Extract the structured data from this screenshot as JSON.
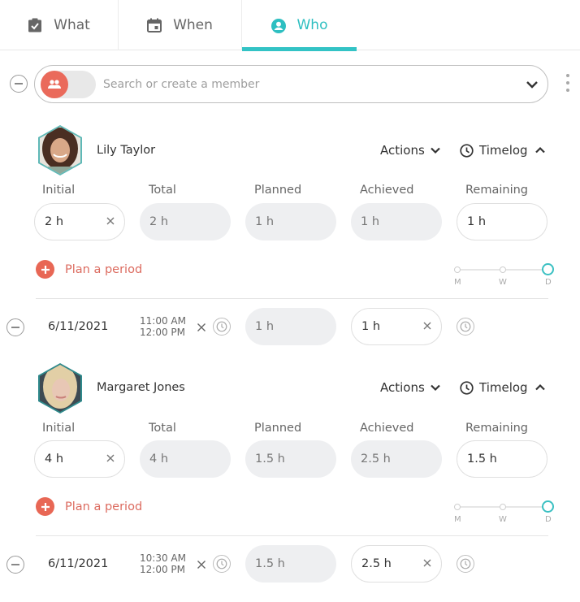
{
  "tabs": [
    {
      "label": "What",
      "icon": "clipboard-check-icon",
      "active": false
    },
    {
      "label": "When",
      "icon": "calendar-icon",
      "active": false
    },
    {
      "label": "Who",
      "icon": "account-circle-icon",
      "active": true
    }
  ],
  "colors": {
    "accent": "#33c3c5",
    "brand_red": "#ea6a5b",
    "readonly_field_bg": "#eeeff1"
  },
  "search": {
    "placeholder": "Search or create a member",
    "value": "",
    "toggle_icon": "group-icon"
  },
  "column_labels": {
    "initial": "Initial",
    "total": "Total",
    "planned": "Planned",
    "achieved": "Achieved",
    "remaining": "Remaining"
  },
  "members": [
    {
      "name": "Lily Taylor",
      "actions_label": "Actions",
      "timelog_label": "Timelog",
      "initial": "2 h",
      "total": "2 h",
      "planned": "1 h",
      "achieved": "1 h",
      "remaining": "1 h",
      "plan_label": "Plan a period",
      "scale": {
        "labels": [
          "M",
          "W",
          "D"
        ],
        "selected": "D"
      },
      "entries": [
        {
          "date": "6/11/2021",
          "start": "11:00 AM",
          "end": "12:00 PM",
          "planned": "1 h",
          "achieved": "1 h"
        }
      ]
    },
    {
      "name": "Margaret Jones",
      "actions_label": "Actions",
      "timelog_label": "Timelog",
      "initial": "4 h",
      "total": "4 h",
      "planned": "1.5 h",
      "achieved": "2.5 h",
      "remaining": "1.5 h",
      "plan_label": "Plan a period",
      "scale": {
        "labels": [
          "M",
          "W",
          "D"
        ],
        "selected": "D"
      },
      "entries": [
        {
          "date": "6/11/2021",
          "start": "10:30 AM",
          "end": "12:00 PM",
          "planned": "1.5 h",
          "achieved": "2.5 h"
        }
      ]
    }
  ]
}
